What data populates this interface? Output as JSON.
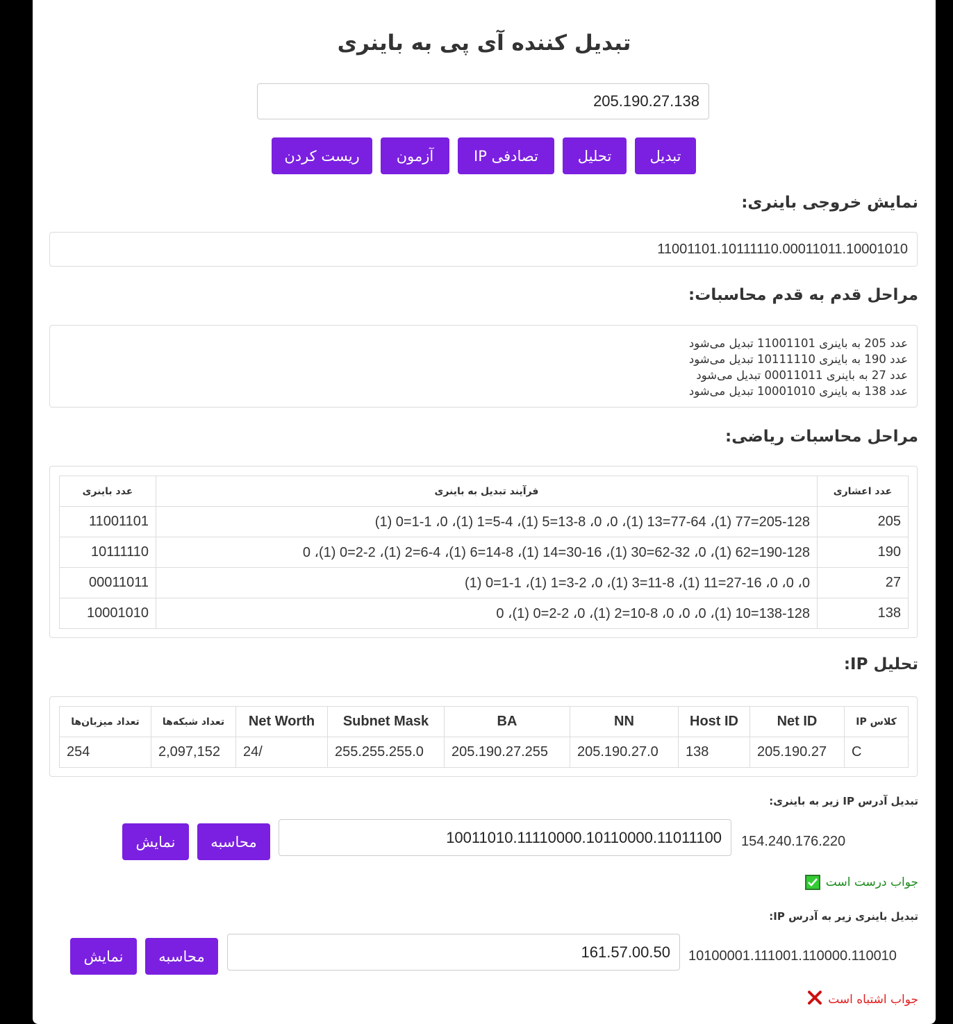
{
  "title": "تبدیل کننده آی پی به باینری",
  "ip_input_value": "205.190.27.138",
  "buttons": {
    "convert": "تبدیل",
    "analyze": "تحلیل",
    "random_ip": "IP تصادفی",
    "quiz": "آزمون",
    "reset": "ریست کردن"
  },
  "binary_output": {
    "heading": "نمایش خروجی باینری:",
    "value": "11001101.10111110.00011011.10001010"
  },
  "steps": {
    "heading": "مراحل قدم به قدم محاسبات:",
    "lines": [
      "عدد 205 به باینری 11001101 تبدیل می‌شود",
      "عدد 190 به باینری 10111110 تبدیل می‌شود",
      "عدد 27 به باینری 00011011 تبدیل می‌شود",
      "عدد 138 به باینری 10001010 تبدیل می‌شود"
    ]
  },
  "math": {
    "heading": "مراحل محاسبات ریاضی:",
    "headers": [
      "عدد اعشاری",
      "فرآیند تبدیل به باینری",
      "عدد باینری"
    ],
    "rows": [
      [
        "205",
        "205-128=77 (1)، 77-64=13 (1)، 0، 0، 13-8=5 (1)، 5-4=1 (1)، 0، 1-1=0 (1)",
        "11001101"
      ],
      [
        "190",
        "190-128=62 (1)، 0، 62-32=30 (1)، 30-16=14 (1)، 14-8=6 (1)، 6-4=2 (1)، 2-2=0 (1)، 0",
        "10111110"
      ],
      [
        "27",
        "0، 0، 0، 27-16=11 (1)، 11-8=3 (1)، 0، 3-2=1 (1)، 1-1=0 (1)",
        "00011011"
      ],
      [
        "138",
        "138-128=10 (1)، 0، 0، 0، 10-8=2 (1)، 0، 2-2=0 (1)، 0",
        "10001010"
      ]
    ]
  },
  "ip_analysis": {
    "heading": "تحلیل IP:",
    "headers": [
      "کلاس IP",
      "Net ID",
      "Host ID",
      "NN",
      "BA",
      "Subnet Mask",
      "Net Worth",
      "تعداد شبکه‌ها",
      "تعداد میزبان‌ها"
    ],
    "row": [
      "C",
      "205.190.27",
      "138",
      "205.190.27.0",
      "205.190.27.255",
      "255.255.255.0",
      "/24",
      "2,097,152",
      "254"
    ]
  },
  "quiz1": {
    "label": "تبدیل آدرس IP زیر به باینری:",
    "question": "154.240.176.220",
    "answer": "10011010.11110000.10110000.11011100",
    "calc_label": "محاسبه",
    "show_label": "نمایش",
    "feedback": "جواب درست است",
    "feedback_color": "#1a8a1a"
  },
  "quiz2": {
    "label": "تبدیل باینری زیر به آدرس IP:",
    "question": "10100001.111001.110000.110010",
    "answer": "161.57.00.50",
    "calc_label": "محاسبه",
    "show_label": "نمایش",
    "feedback": "جواب اشتباه است",
    "feedback_color": "#e02020"
  },
  "colors": {
    "accent": "#7b20e0"
  }
}
